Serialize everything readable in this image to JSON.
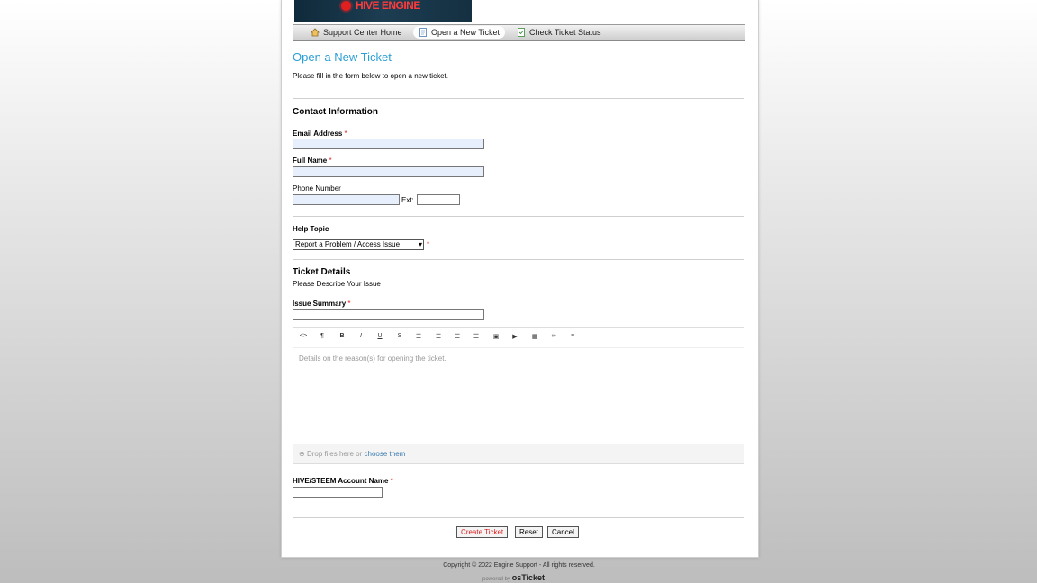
{
  "banner": {
    "logo_text": "HIVE ENGINE"
  },
  "nav": {
    "items": [
      {
        "label": "Support Center Home"
      },
      {
        "label": "Open a New Ticket"
      },
      {
        "label": "Check Ticket Status"
      }
    ]
  },
  "page": {
    "title": "Open a New Ticket",
    "intro": "Please fill in the form below to open a new ticket."
  },
  "contact": {
    "title": "Contact Information",
    "email_label": "Email Address",
    "name_label": "Full Name",
    "phone_label": "Phone Number",
    "ext_label": "Ext:",
    "required_mark": "*"
  },
  "help": {
    "label": "Help Topic",
    "selected": "Report a Problem / Access Issue"
  },
  "details": {
    "title": "Ticket Details",
    "subtitle": "Please Describe Your Issue",
    "summary_label": "Issue Summary",
    "editor_placeholder": "Details on the reason(s) for opening the ticket.",
    "drop_text": "Drop files here or",
    "drop_link": "choose them"
  },
  "account": {
    "label": "HIVE/STEEM Account Name"
  },
  "buttons": {
    "create": "Create Ticket",
    "reset": "Reset",
    "cancel": "Cancel"
  },
  "footer": {
    "copyright": "Copyright © 2022 Engine Support - All rights reserved.",
    "powered_by": "powered by",
    "brand": "osTicket"
  },
  "colors": {
    "accent": "#2a9fd6",
    "required": "#e02020",
    "input_bg": "#e8effc"
  },
  "icons": {
    "home": "home-icon",
    "new_ticket": "new-ticket-icon",
    "status": "ticket-status-icon"
  }
}
